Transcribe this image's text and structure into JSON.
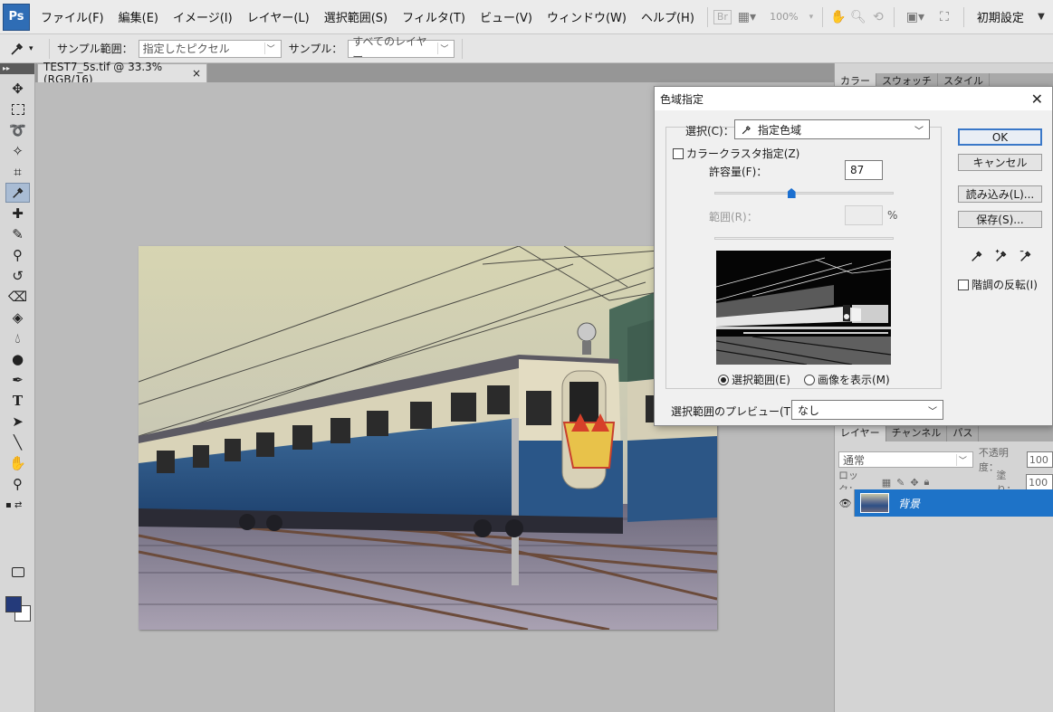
{
  "menubar": {
    "logo": "Ps",
    "items": [
      "ファイル(F)",
      "編集(E)",
      "イメージ(I)",
      "レイヤー(L)",
      "選択範囲(S)",
      "フィルタ(T)",
      "ビュー(V)",
      "ウィンドウ(W)",
      "ヘルプ(H)"
    ],
    "bridge_label": "Br",
    "zoom_value": "100%",
    "workspace_label": "初期設定"
  },
  "options_bar": {
    "sample_size_label": "サンプル範囲：",
    "sample_size_value": "指定したピクセル",
    "sample_label": "サンプル：",
    "sample_value": "すべてのレイヤー"
  },
  "document": {
    "tab_title": "TEST7_5s.tif @ 33.3% (RGB/16)",
    "close_glyph": "×"
  },
  "right_panels": {
    "top_tabs": [
      "カラー",
      "スウォッチ",
      "スタイル"
    ],
    "layer_tabs": [
      "レイヤー",
      "チャンネル",
      "パス"
    ],
    "blend_mode": "通常",
    "opacity_label": "不透明度：",
    "opacity_value": "100",
    "lock_label": "ロック：",
    "fill_label": "塗り：",
    "fill_value": "100",
    "layer_name": "背景"
  },
  "dialog": {
    "title": "色域指定",
    "close_glyph": "✕",
    "select_label": "選択(C)：",
    "select_value": "指定色域",
    "cluster_label": "カラークラスタ指定(Z)",
    "fuzziness_label": "許容量(F)：",
    "fuzziness_value": "87",
    "fuzziness_slider": 0.43,
    "range_label": "範囲(R)：",
    "range_unit": "%",
    "radio_selection_label": "選択範囲(E)",
    "radio_image_label": "画像を表示(M)",
    "preview_label": "選択範囲のプレビュー(T)：",
    "preview_value": "なし",
    "ok_label": "OK",
    "cancel_label": "キャンセル",
    "load_label": "読み込み(L)...",
    "save_label": "保存(S)...",
    "invert_label": "階調の反転(I)"
  },
  "colors": {
    "accent": "#1e73c8",
    "foreground": "#243a7a",
    "background": "#ffffff"
  }
}
